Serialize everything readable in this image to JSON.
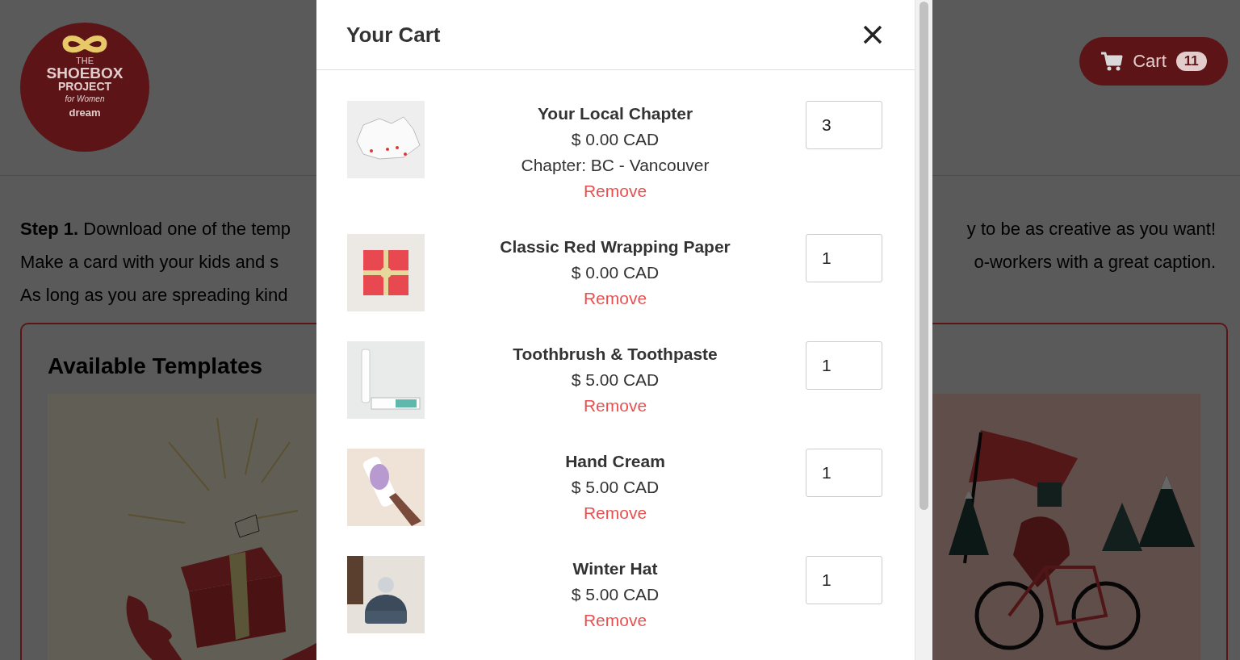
{
  "header": {
    "logo": {
      "lines": [
        "THE",
        "SHOEBOX",
        "PROJECT"
      ],
      "tagline": "for Women",
      "brand": "dream"
    },
    "cart_button": {
      "label": "Cart",
      "count": "11"
    }
  },
  "intro": {
    "left_lines": [
      "**Step 1.** Download one of the temp",
      "Make a card with your kids and s",
      "As long as you are spreading kind"
    ],
    "right_lines": [
      "y to be as creative as you want!",
      "o-workers with a great caption."
    ]
  },
  "templates": {
    "title": "Available Templates"
  },
  "cart_modal": {
    "title": "Your Cart",
    "items": [
      {
        "name": "Your Local Chapter",
        "price": "$ 0.00 CAD",
        "detail": "Chapter: BC - Vancouver",
        "remove": "Remove",
        "quantity": "3"
      },
      {
        "name": "Classic Red Wrapping Paper",
        "price": "$ 0.00 CAD",
        "remove": "Remove",
        "quantity": "1"
      },
      {
        "name": "Toothbrush & Toothpaste",
        "price": "$ 5.00 CAD",
        "remove": "Remove",
        "quantity": "1"
      },
      {
        "name": "Hand Cream",
        "price": "$ 5.00 CAD",
        "remove": "Remove",
        "quantity": "1"
      },
      {
        "name": "Winter Hat",
        "price": "$ 5.00 CAD",
        "remove": "Remove",
        "quantity": "1"
      }
    ]
  }
}
